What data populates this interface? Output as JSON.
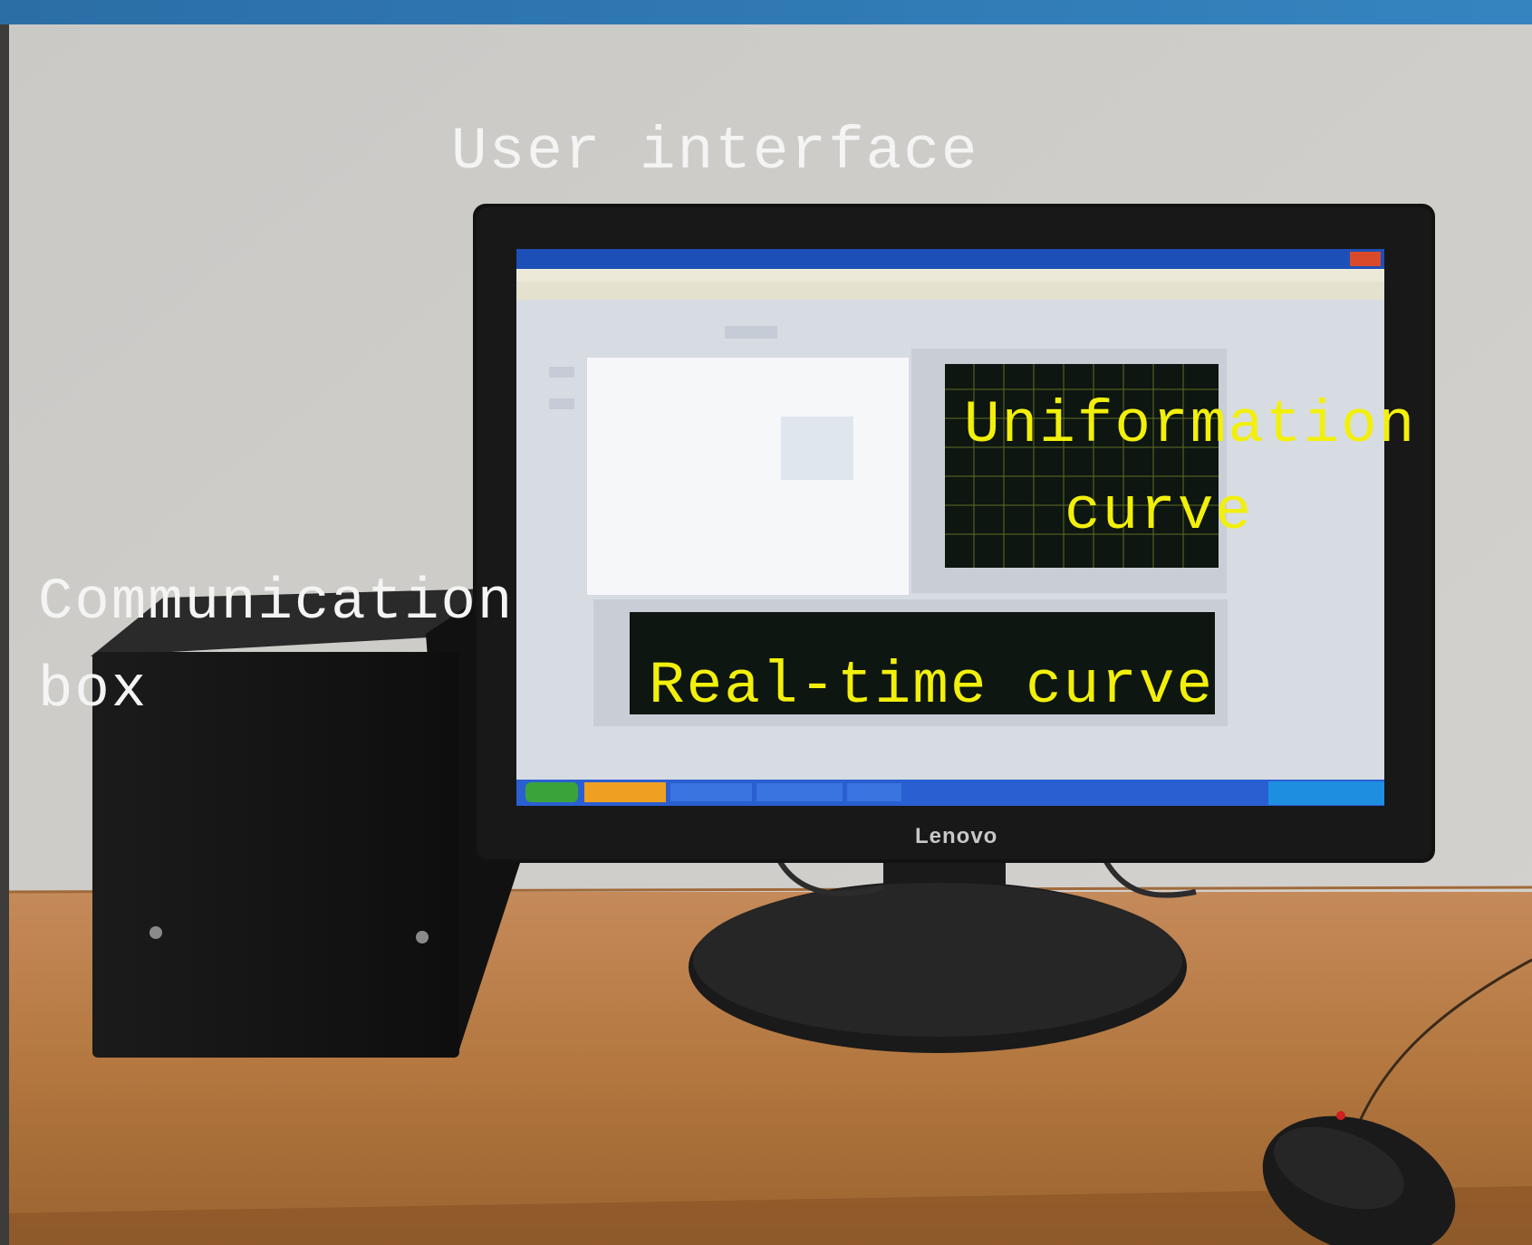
{
  "labels": {
    "user_interface": "User interface",
    "communication_box_line1": "Communication",
    "communication_box_line2": "box",
    "uniformation_line1": "Uniformation",
    "uniformation_line2": "curve",
    "realtime": "Real-time curve"
  },
  "brand": "Lenovo",
  "colors": {
    "annotation_white": "#f4f4f4",
    "annotation_yellow": "#f2f00a",
    "top_banner": "#2d74ad"
  }
}
